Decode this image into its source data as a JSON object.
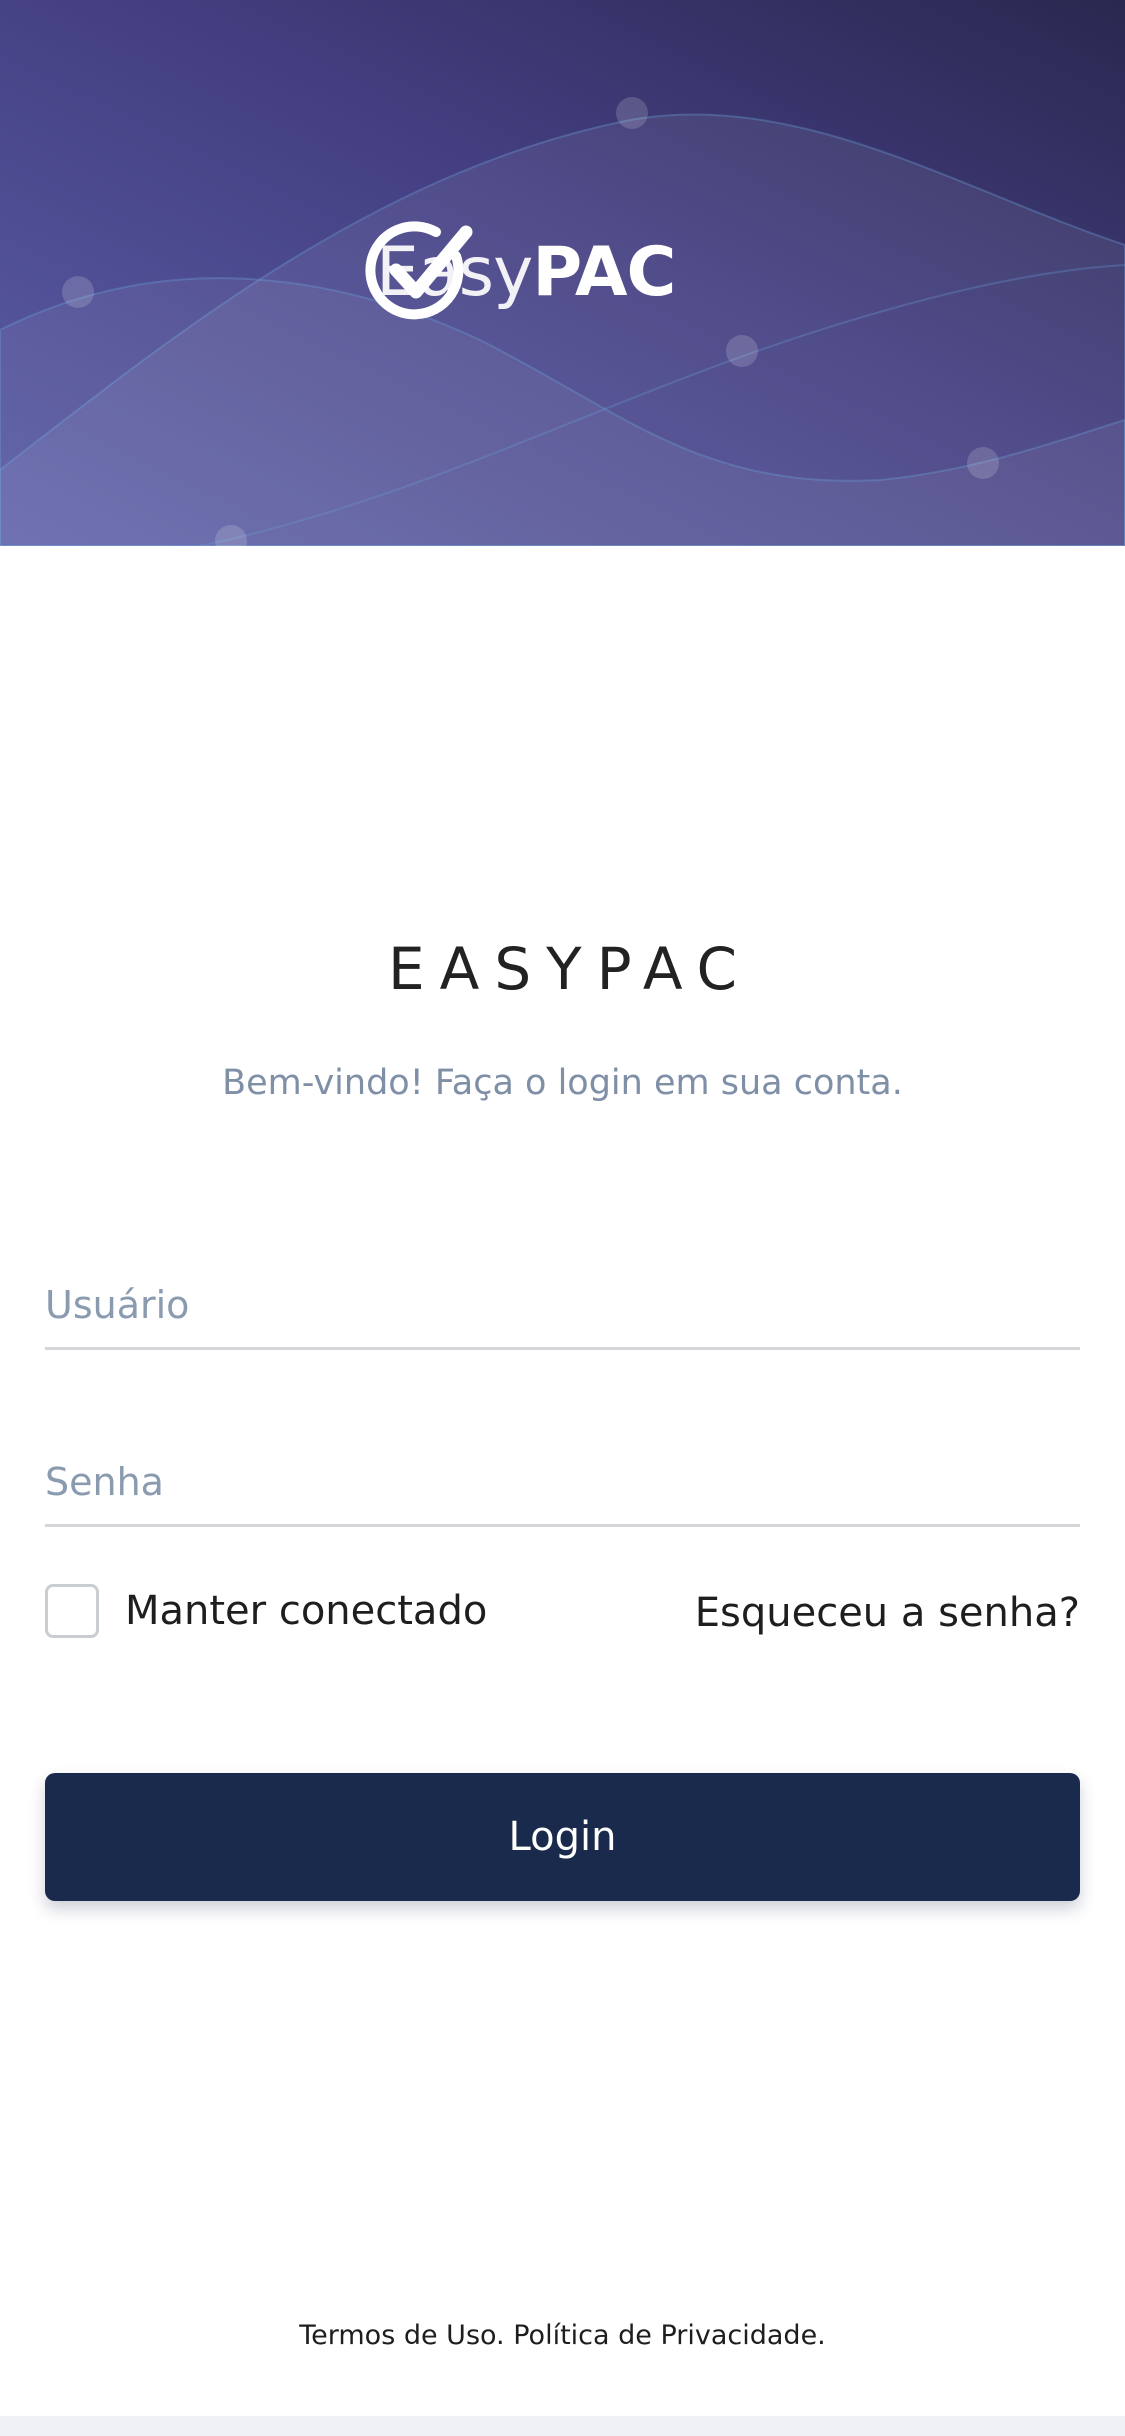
{
  "header": {
    "logo_light": "Easy",
    "logo_bold": "PAC",
    "gradient_start": "#5c5fa8",
    "gradient_end": "#2a2850"
  },
  "main": {
    "title": "EASYPAC",
    "welcome": "Bem-vindo! Faça o login em sua conta."
  },
  "form": {
    "username_placeholder": "Usuário",
    "username_value": "",
    "password_placeholder": "Senha",
    "password_value": "",
    "remember_label": "Manter conectado",
    "remember_checked": false,
    "forgot_label": "Esqueceu a senha?",
    "login_label": "Login",
    "login_color": "#1a2a4c"
  },
  "footer": {
    "terms": "Termos de Uso.",
    "privacy": "Política de Privacidade."
  }
}
